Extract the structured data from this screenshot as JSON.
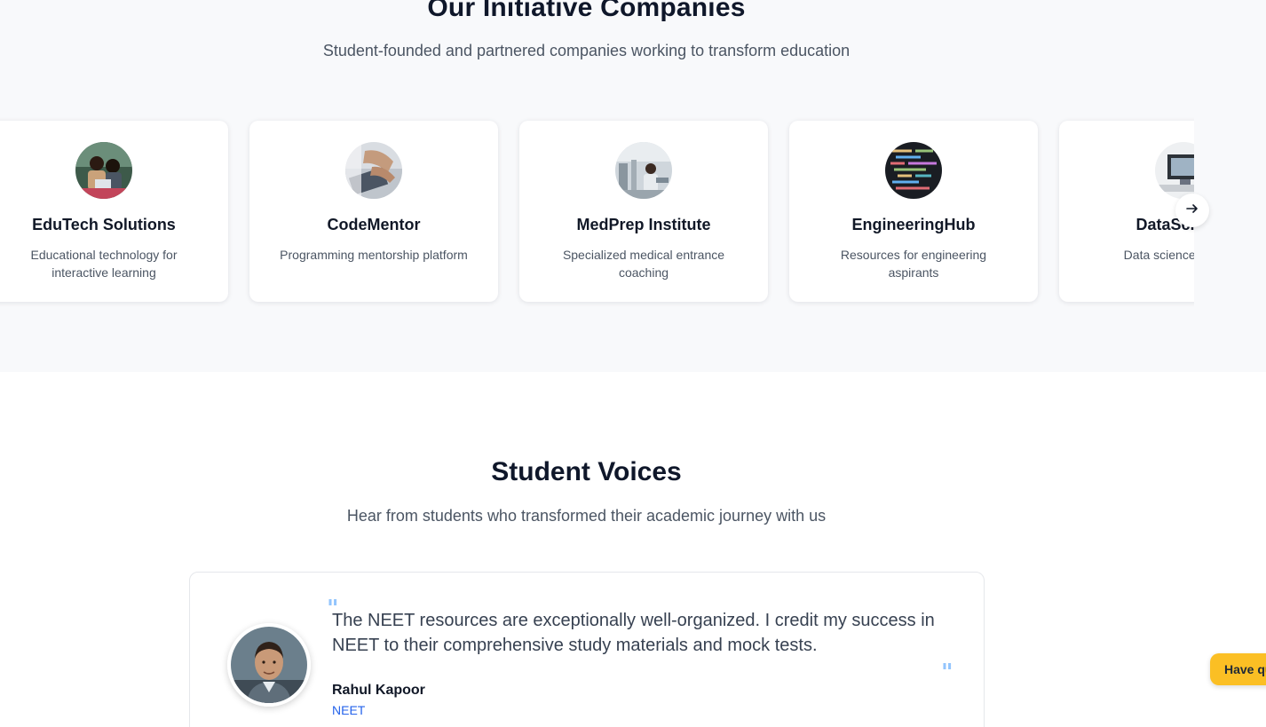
{
  "companies": {
    "title": "Our Initiative Companies",
    "subtitle": "Student-founded and partnered companies working to transform education",
    "cards": [
      {
        "name": "EduTech Solutions",
        "description": "Educational technology for interactive learning",
        "logo_icon": "edutech-logo-icon"
      },
      {
        "name": "CodeMentor",
        "description": "Programming mentorship platform",
        "logo_icon": "codementor-logo-icon"
      },
      {
        "name": "MedPrep Institute",
        "description": "Specialized medical entrance coaching",
        "logo_icon": "medprep-logo-icon"
      },
      {
        "name": "EngineeringHub",
        "description": "Resources for engineering aspirants",
        "logo_icon": "engineeringhub-logo-icon"
      },
      {
        "name": "DataScience",
        "description": "Data science learning",
        "logo_icon": "datascience-logo-icon"
      }
    ],
    "next_icon": "arrow-right-icon"
  },
  "voices": {
    "title": "Student Voices",
    "subtitle": "Hear from students who transformed their academic journey with us",
    "testimonial": {
      "quote_open": "\"",
      "quote_close": "\"",
      "quote": "The NEET resources are exceptionally well-organized. I credit my success in NEET to their comprehensive study materials and mock tests.",
      "author": "Rahul Kapoor",
      "program": "NEET"
    }
  },
  "help_button": {
    "label": "Have questions?"
  },
  "colors": {
    "accent": "#2563eb",
    "help": "#fbbf24",
    "quote_mark": "#93c5fd",
    "section_bg": "#f8f9fb"
  }
}
